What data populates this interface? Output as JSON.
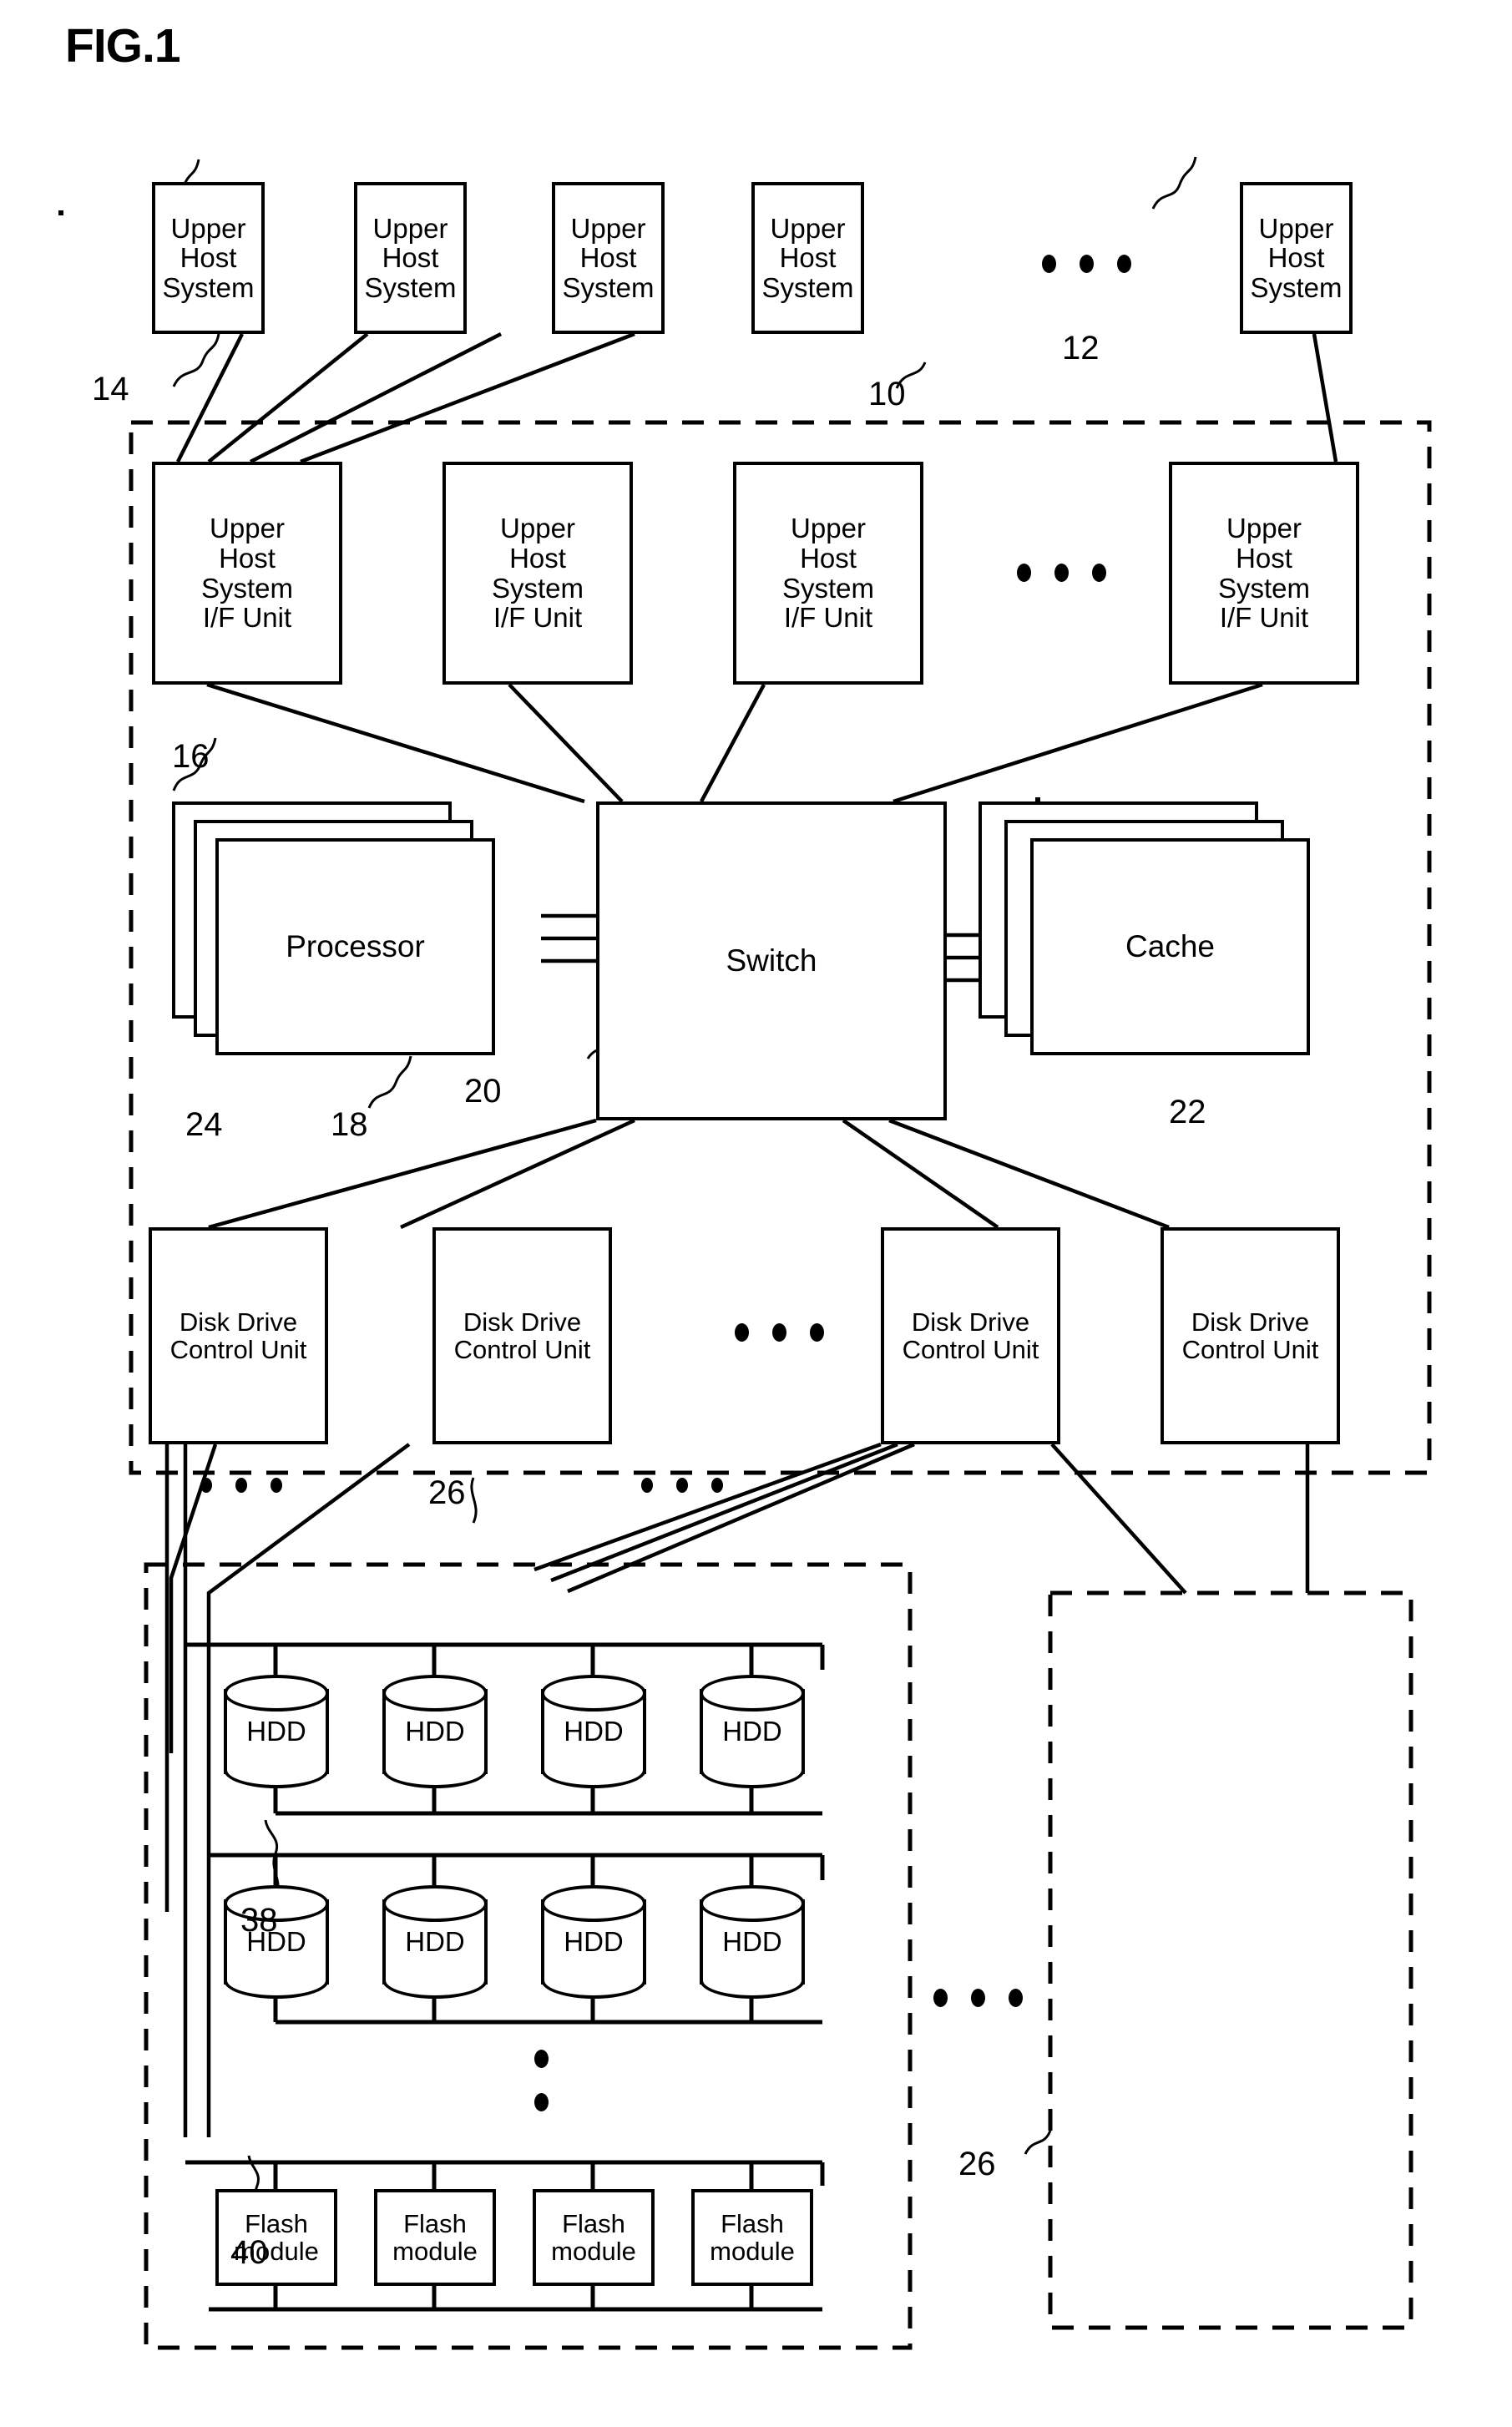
{
  "figure": {
    "title": "FIG.1"
  },
  "host_systems": {
    "label": "Upper\nHost\nSystem",
    "count_shown": 5,
    "ellipsis": "• • •",
    "ref_host": "10",
    "ref_link": "14",
    "ref_group": "12"
  },
  "if_units": {
    "label": "Upper\nHost\nSystem\nI/F Unit",
    "count_shown": 4,
    "ref": "16"
  },
  "controller": {
    "processor": {
      "label": "Processor",
      "ref": "18",
      "stack_ref": "24",
      "stack_layers": 3
    },
    "switch": {
      "label": "Switch",
      "ref": "20"
    },
    "cache": {
      "label": "Cache",
      "ref": "22",
      "stack_layers": 3
    }
  },
  "disk_control_units": {
    "label": "Disk Drive\nControl Unit",
    "count_shown": 4,
    "ref": "26"
  },
  "enclosure": {
    "ref_left": "26",
    "ref_right": "26",
    "hdd": {
      "label": "HDD",
      "ref": "38",
      "rows": 2,
      "per_row": 4
    },
    "flash": {
      "label": "Flash\nmodule",
      "ref": "40",
      "count": 4
    }
  }
}
